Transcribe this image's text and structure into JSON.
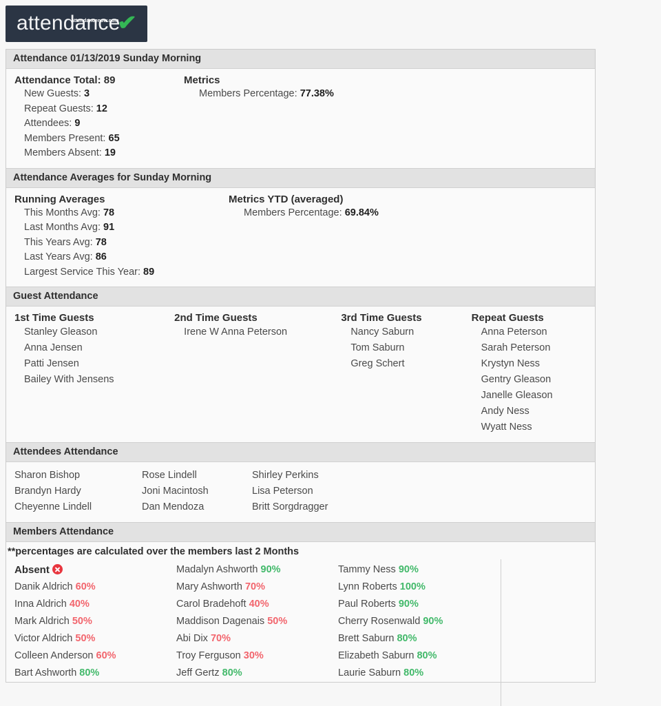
{
  "logo": {
    "word": "attendance",
    "superscript": "attendancenow.com",
    "check": "✔",
    "check_color": "#34b755",
    "background": "#2b3544"
  },
  "colors": {
    "section_header_bg": "#e2e2e2",
    "panel_bg": "#fafafa",
    "pct_low": "#f2656d",
    "pct_high": "#42b96a",
    "absent_icon": "#e8363f"
  },
  "attendance_summary": {
    "header": "Attendance 01/13/2019 Sunday Morning",
    "total_label": "Attendance Total:",
    "total_value": "89",
    "lines": [
      {
        "label": "New Guests:",
        "value": "3"
      },
      {
        "label": "Repeat Guests:",
        "value": "12"
      },
      {
        "label": "Attendees:",
        "value": "9"
      },
      {
        "label": "Members Present:",
        "value": "65"
      },
      {
        "label": "Members Absent:",
        "value": "19"
      }
    ],
    "metrics_title": "Metrics",
    "metrics": [
      {
        "label": "Members Percentage:",
        "value": "77.38%"
      }
    ]
  },
  "averages": {
    "header": "Attendance Averages for Sunday Morning",
    "running_title": "Running Averages",
    "running": [
      {
        "label": "This Months Avg:",
        "value": "78"
      },
      {
        "label": "Last Months Avg:",
        "value": "91"
      },
      {
        "label": "This Years Avg:",
        "value": "78"
      },
      {
        "label": "Last Years Avg:",
        "value": "86"
      },
      {
        "label": "Largest Service This Year:",
        "value": "89"
      }
    ],
    "ytd_title": "Metrics YTD (averaged)",
    "ytd": [
      {
        "label": "Members Percentage:",
        "value": "69.84%"
      }
    ]
  },
  "guests": {
    "header": "Guest Attendance",
    "columns": [
      {
        "title": "1st Time Guests",
        "names": [
          "Stanley Gleason",
          "Anna Jensen",
          "Patti Jensen",
          "Bailey With Jensens"
        ]
      },
      {
        "title": "2nd Time Guests",
        "names": [
          "Irene W Anna Peterson"
        ]
      },
      {
        "title": "3rd Time Guests",
        "names": [
          "Nancy Saburn",
          "Tom Saburn",
          "Greg Schert"
        ]
      },
      {
        "title": "Repeat Guests",
        "names": [
          "Anna Peterson",
          "Sarah Peterson",
          "Krystyn Ness",
          "Gentry Gleason",
          "Janelle Gleason",
          "Andy Ness",
          "Wyatt Ness"
        ]
      }
    ]
  },
  "attendees": {
    "header": "Attendees Attendance",
    "columns": [
      [
        "Sharon Bishop",
        "Brandyn Hardy",
        "Cheyenne Lindell"
      ],
      [
        "Rose Lindell",
        "Joni Macintosh",
        "Dan Mendoza"
      ],
      [
        "Shirley Perkins",
        "Lisa Peterson",
        "Britt Sorgdragger"
      ]
    ]
  },
  "members": {
    "header": "Members Attendance",
    "note": "**percentages are calculated over the members last 2 Months",
    "absent_label": "Absent",
    "absent_icon": "circle-x-icon",
    "columns": [
      [
        {
          "name": "Danik Aldrich",
          "pct": "60%",
          "level": "low"
        },
        {
          "name": "Inna Aldrich",
          "pct": "40%",
          "level": "low"
        },
        {
          "name": "Mark Aldrich",
          "pct": "50%",
          "level": "low"
        },
        {
          "name": "Victor Aldrich",
          "pct": "50%",
          "level": "low"
        },
        {
          "name": "Colleen Anderson",
          "pct": "60%",
          "level": "low"
        },
        {
          "name": "Bart Ashworth",
          "pct": "80%",
          "level": "high"
        }
      ],
      [
        {
          "name": "Madalyn Ashworth",
          "pct": "90%",
          "level": "high"
        },
        {
          "name": "Mary Ashworth",
          "pct": "70%",
          "level": "low"
        },
        {
          "name": "Carol Bradehoft",
          "pct": "40%",
          "level": "low"
        },
        {
          "name": "Maddison Dagenais",
          "pct": "50%",
          "level": "low"
        },
        {
          "name": "Abi Dix",
          "pct": "70%",
          "level": "low"
        },
        {
          "name": "Troy Ferguson",
          "pct": "30%",
          "level": "low"
        },
        {
          "name": "Jeff Gertz",
          "pct": "80%",
          "level": "high"
        }
      ],
      [
        {
          "name": "Tammy Ness",
          "pct": "90%",
          "level": "high"
        },
        {
          "name": "Lynn Roberts",
          "pct": "100%",
          "level": "high"
        },
        {
          "name": "Paul Roberts",
          "pct": "90%",
          "level": "high"
        },
        {
          "name": "Cherry Rosenwald",
          "pct": "90%",
          "level": "high"
        },
        {
          "name": "Brett Saburn",
          "pct": "80%",
          "level": "high"
        },
        {
          "name": "Elizabeth Saburn",
          "pct": "80%",
          "level": "high"
        },
        {
          "name": "Laurie Saburn",
          "pct": "80%",
          "level": "high"
        }
      ]
    ]
  }
}
